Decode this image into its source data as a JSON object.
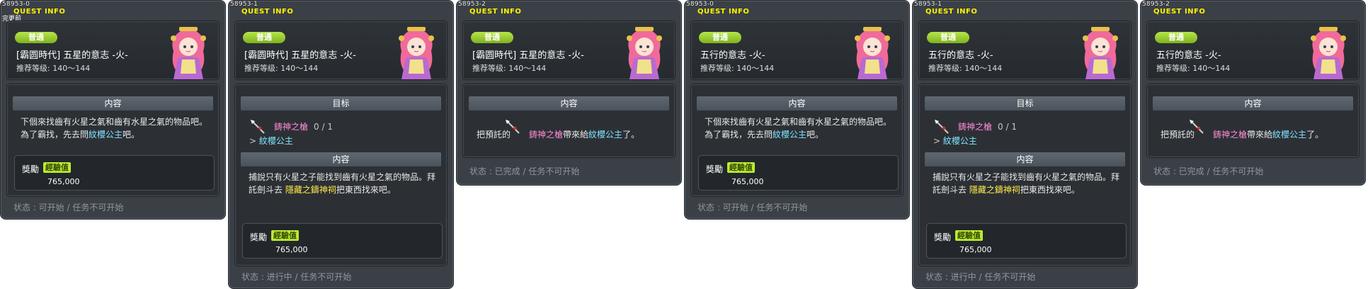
{
  "panels": [
    {
      "id": "58953-0",
      "title": "QUEST INFO",
      "sub": "完更前",
      "grade": "普通",
      "name": "[霸圆時代] 五星的意志 -火-",
      "level": "推荐等级: 140～144",
      "content_header": "内容",
      "content_lines": [
        "下個來找齒有火星之氣和齒有水星之氣的物品吧。",
        "為了霸找，先去問"
      ],
      "content_npc": "紋櫻公主",
      "content_tail": "吧。",
      "reward_label": "獎勵",
      "reward_exp": "經驗值",
      "reward_amount": "765,000",
      "status": "状态 : 可开始  /  任务不可开始"
    },
    {
      "id": "58953-1",
      "title": "QUEST INFO",
      "grade": "普通",
      "name": "[霸圆時代] 五星的意志 -火-",
      "level": "推荐等级: 140～144",
      "goal_header": "目标",
      "goal_item": "鋳神之槍",
      "goal_count": "0 / 1",
      "goal_arrow": ">",
      "goal_npc": "紋櫻公主",
      "content_header": "内容",
      "content_line1": "捕說只有火星之子能找到齒有火星之氣的物品。拜",
      "content_line2_a": "託劍斗去",
      "content_place": "隱藏之鑄神祠",
      "content_line2_b": "把東西找來吧。",
      "reward_label": "獎勵",
      "reward_exp": "經驗值",
      "reward_amount": "765,000",
      "status": "状态 : 进行中  /  任务不可开始"
    },
    {
      "id": "58953-2",
      "title": "QUEST INFO",
      "grade": "普通",
      "name": "[霸圆時代] 五星的意志 -火-",
      "level": "推荐等级: 140～144",
      "content_header": "内容",
      "deliver_a": "把預託的",
      "deliver_item": "鋳神之槍",
      "deliver_b": "帶來給",
      "deliver_npc": "紋櫻公主",
      "deliver_c": "了。",
      "status": "状态 : 已完成  /  任务不可开始"
    },
    {
      "id": "58953-0",
      "title": "QUEST INFO",
      "grade": "普通",
      "name": "五行的意志 -火-",
      "level": "推荐等级: 140～144",
      "content_header": "内容",
      "content_lines": [
        "下個來找齒有火星之氣和齒有水星之氣的物品吧。",
        "為了霸找，先去問"
      ],
      "content_npc": "紋櫻公主",
      "content_tail": "吧。",
      "reward_label": "獎勵",
      "reward_exp": "經驗值",
      "reward_amount": "765,000",
      "status": "状态 : 可开始  /  任务不可开始"
    },
    {
      "id": "58953-1",
      "title": "QUEST INFO",
      "grade": "普通",
      "name": "五行的意志 -火-",
      "level": "推荐等级: 140～144",
      "goal_header": "目标",
      "goal_item": "鋳神之槍",
      "goal_count": "0 / 1",
      "goal_arrow": ">",
      "goal_npc": "紋櫻公主",
      "content_header": "内容",
      "content_line1": "捕說只有火星之子能找到齒有火星之氣的物品。拜",
      "content_line2_a": "託劍斗去",
      "content_place": "隱藏之鑄神祠",
      "content_line2_b": "把東西找來吧。",
      "reward_label": "獎勵",
      "reward_exp": "經驗值",
      "reward_amount": "765,000",
      "status": "状态 : 进行中  /  任务不可开始"
    },
    {
      "id": "58953-2",
      "title": "QUEST INFO",
      "grade": "普通",
      "name": "五行的意志 -火-",
      "level": "推荐等级: 140～144",
      "content_header": "内容",
      "deliver_a": "把預託的",
      "deliver_item": "鋳神之槍",
      "deliver_b": "帶來給",
      "deliver_npc": "紋櫻公主",
      "deliver_c": "了。",
      "status": "状态 : 已完成  /  任务不可开始"
    }
  ],
  "colors": {
    "grade_badge": "#8fc42a",
    "npc_text": "#7fe3ff",
    "item_text": "#ff8ad6",
    "place_text": "#ffea4a",
    "title_text": "#fff200",
    "exp_badge": "#b9ec33"
  },
  "icons": {
    "portrait": "princess-portrait-icon",
    "item": "spear-icon"
  }
}
